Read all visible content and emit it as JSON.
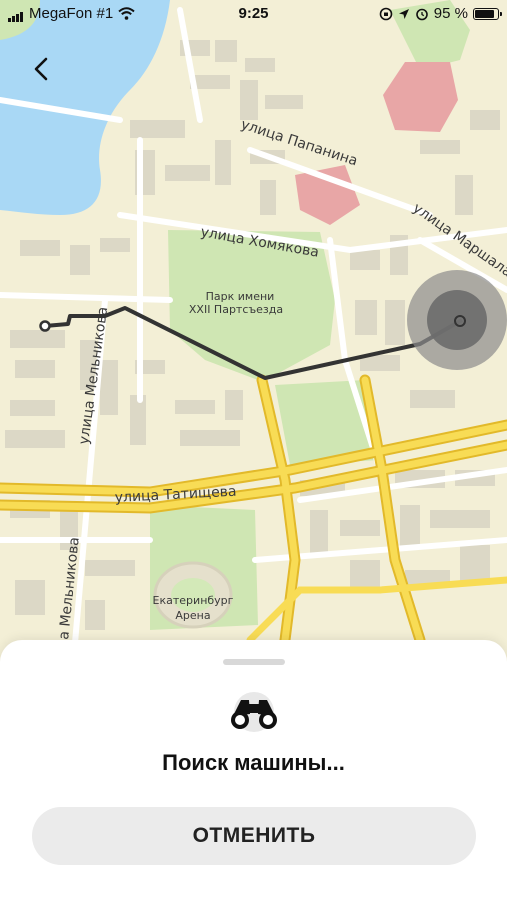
{
  "status_bar": {
    "carrier": "MegaFon #1",
    "time": "9:25",
    "battery_percent_label": "95 %",
    "battery_level": 0.95,
    "icons": [
      "signal-icon",
      "wifi-icon",
      "orientation-lock-icon",
      "location-arrow-icon",
      "alarm-icon",
      "battery-icon"
    ]
  },
  "nav": {
    "back_icon": "chevron-left-icon"
  },
  "map": {
    "streets": {
      "papanina": "улица Папанина",
      "marshala": "улица Маршала",
      "khomyakova": "улица Хомякова",
      "melnikova_1": "улица Мельникова",
      "melnikova_2": "а Мельникова",
      "tatishcheva": "улица Татищева"
    },
    "park_line1": "Парк имени",
    "park_line2": "XXII Партсъезда",
    "arena_line1": "Екатеринбург",
    "arena_line2": "Арена",
    "colors": {
      "background": "#f3efd6",
      "water": "#a9d8f5",
      "park": "#cfe6b3",
      "buildings": "#dcd8c6",
      "main_road": "#f5d13a",
      "route": "#333333",
      "special_building": "#e8a6a6"
    }
  },
  "sheet": {
    "status_title": "Поиск машины...",
    "search_icon": "binoculars-icon",
    "cancel_label": "ОТМЕНИТЬ"
  }
}
